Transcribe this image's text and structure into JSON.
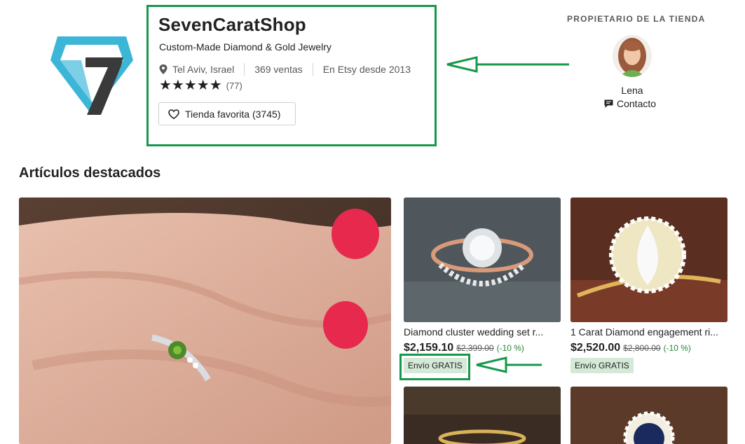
{
  "shop": {
    "name": "SevenCaratShop",
    "tagline": "Custom-Made Diamond & Gold Jewelry",
    "location": "Tel Aviv, Israel",
    "sales": "369 ventas",
    "since": "En Etsy desde 2013",
    "stars": "★★★★★",
    "rating_count": "(77)",
    "favorite_label": "Tienda favorita (3745)",
    "logo_icon": "diamond-seven-logo"
  },
  "owner": {
    "heading": "PROPIETARIO DE LA TIENDA",
    "name": "Lena",
    "contact_label": "Contacto",
    "contact_icon": "message-icon"
  },
  "featured": {
    "title": "Artículos destacados",
    "items": [
      {
        "title": "Diamond cluster wedding set r...",
        "price": "$2,159.10",
        "old_price": "$2,399.00",
        "discount": "(-10 %)",
        "shipping": "Envío GRATIS"
      },
      {
        "title": "1 Carat Diamond engagement ri...",
        "price": "$2,520.00",
        "old_price": "$2,800.00",
        "discount": "(-10 %)",
        "shipping": "Envío GRATIS"
      }
    ]
  },
  "colors": {
    "annotation_green": "#16984a",
    "discount_green": "#258635",
    "badge_bg": "#d4e9d7"
  }
}
